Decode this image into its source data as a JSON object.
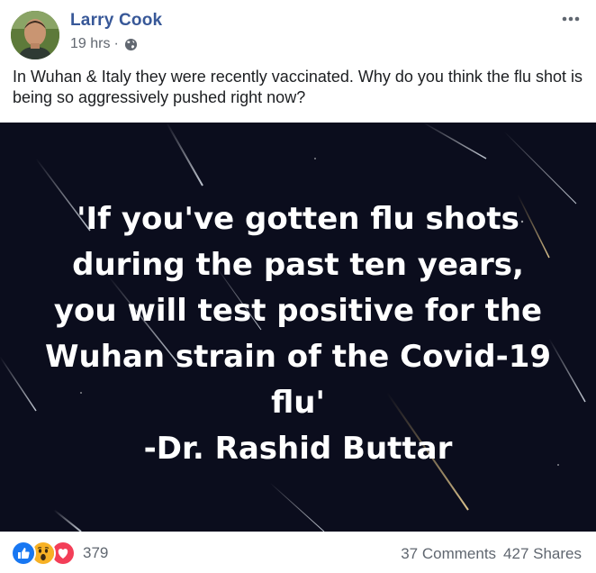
{
  "post": {
    "author": "Larry Cook",
    "time": "19 hrs",
    "separator": "·",
    "audience_icon": "globe-icon",
    "more_icon": "more-options-icon",
    "caption": "In Wuhan & Italy they were recently vaccinated. Why do you think the flu shot is being so aggressively pushed right now?"
  },
  "image": {
    "quote_lines": [
      "'If you've gotten flu shots",
      "during the past ten years,",
      "you will test positive for the",
      "Wuhan strain of the Covid-19",
      "flu'"
    ],
    "attribution": "-Dr. Rashid Buttar",
    "background_color": "#0b0d1d"
  },
  "footer": {
    "reaction_icons": [
      "like-icon",
      "wow-icon",
      "love-icon"
    ],
    "reaction_count": "379",
    "comments": "37 Comments",
    "shares": "427 Shares"
  },
  "colors": {
    "author": "#385898",
    "meta": "#616770",
    "like": "#1877f2",
    "wow": "#f7b125",
    "love": "#f33e58"
  }
}
